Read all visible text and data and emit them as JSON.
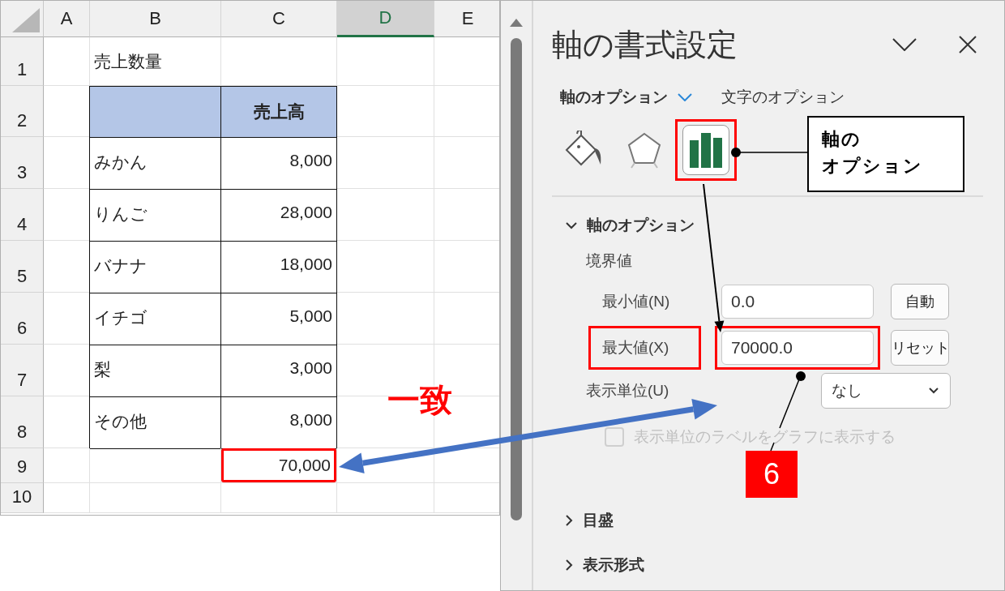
{
  "sheet": {
    "columns": [
      {
        "label": "A",
        "selected": false
      },
      {
        "label": "B",
        "selected": false
      },
      {
        "label": "C",
        "selected": false
      },
      {
        "label": "D",
        "selected": true
      },
      {
        "label": "E",
        "selected": false
      }
    ],
    "rows": [
      {
        "number": "1",
        "kind": "title",
        "text": "売上数量"
      },
      {
        "number": "2",
        "kind": "header",
        "text": "売上高"
      },
      {
        "number": "3",
        "kind": "item",
        "name": "みかん",
        "amount": "8,000"
      },
      {
        "number": "4",
        "kind": "item",
        "name": "りんご",
        "amount": "28,000"
      },
      {
        "number": "5",
        "kind": "item",
        "name": "バナナ",
        "amount": "18,000"
      },
      {
        "number": "6",
        "kind": "item",
        "name": "イチゴ",
        "amount": "5,000"
      },
      {
        "number": "7",
        "kind": "item",
        "name": "梨",
        "amount": "3,000"
      },
      {
        "number": "8",
        "kind": "item",
        "name": "その他",
        "amount": "8,000"
      },
      {
        "number": "9",
        "kind": "total",
        "amount": "70,000",
        "highlighted": true
      },
      {
        "number": "10",
        "kind": "blank"
      }
    ]
  },
  "panel": {
    "title": "軸の書式設定",
    "tabs": [
      {
        "label": "軸のオプション",
        "selected": true
      },
      {
        "label": "文字のオプション",
        "selected": false
      }
    ],
    "icon_tabs": [
      {
        "kind": "fill",
        "selected": false,
        "highlighted": false
      },
      {
        "kind": "shape",
        "selected": false,
        "highlighted": false
      },
      {
        "kind": "chart",
        "selected": true,
        "highlighted": true
      }
    ],
    "sections": [
      {
        "title": "軸のオプション",
        "expanded": true
      },
      {
        "title": "目盛",
        "expanded": false
      },
      {
        "title": "表示形式",
        "expanded": false
      }
    ],
    "bounds_label": "境界値",
    "fields": [
      {
        "label": "最小値(N)",
        "value": "0.0",
        "button": "自動",
        "highlighted": false
      },
      {
        "label": "最大値(X)",
        "value": "70000.0",
        "button": "リセット",
        "highlighted": true
      }
    ],
    "unit": {
      "label": "表示単位(U)",
      "value": "なし"
    },
    "unit_checkbox": {
      "label": "表示単位のラベルをグラフに表示する",
      "checked": false,
      "disabled": true
    }
  },
  "annotations": {
    "callout": [
      "軸の",
      "オプション"
    ],
    "match_label": "一致",
    "step_badge": "6"
  }
}
